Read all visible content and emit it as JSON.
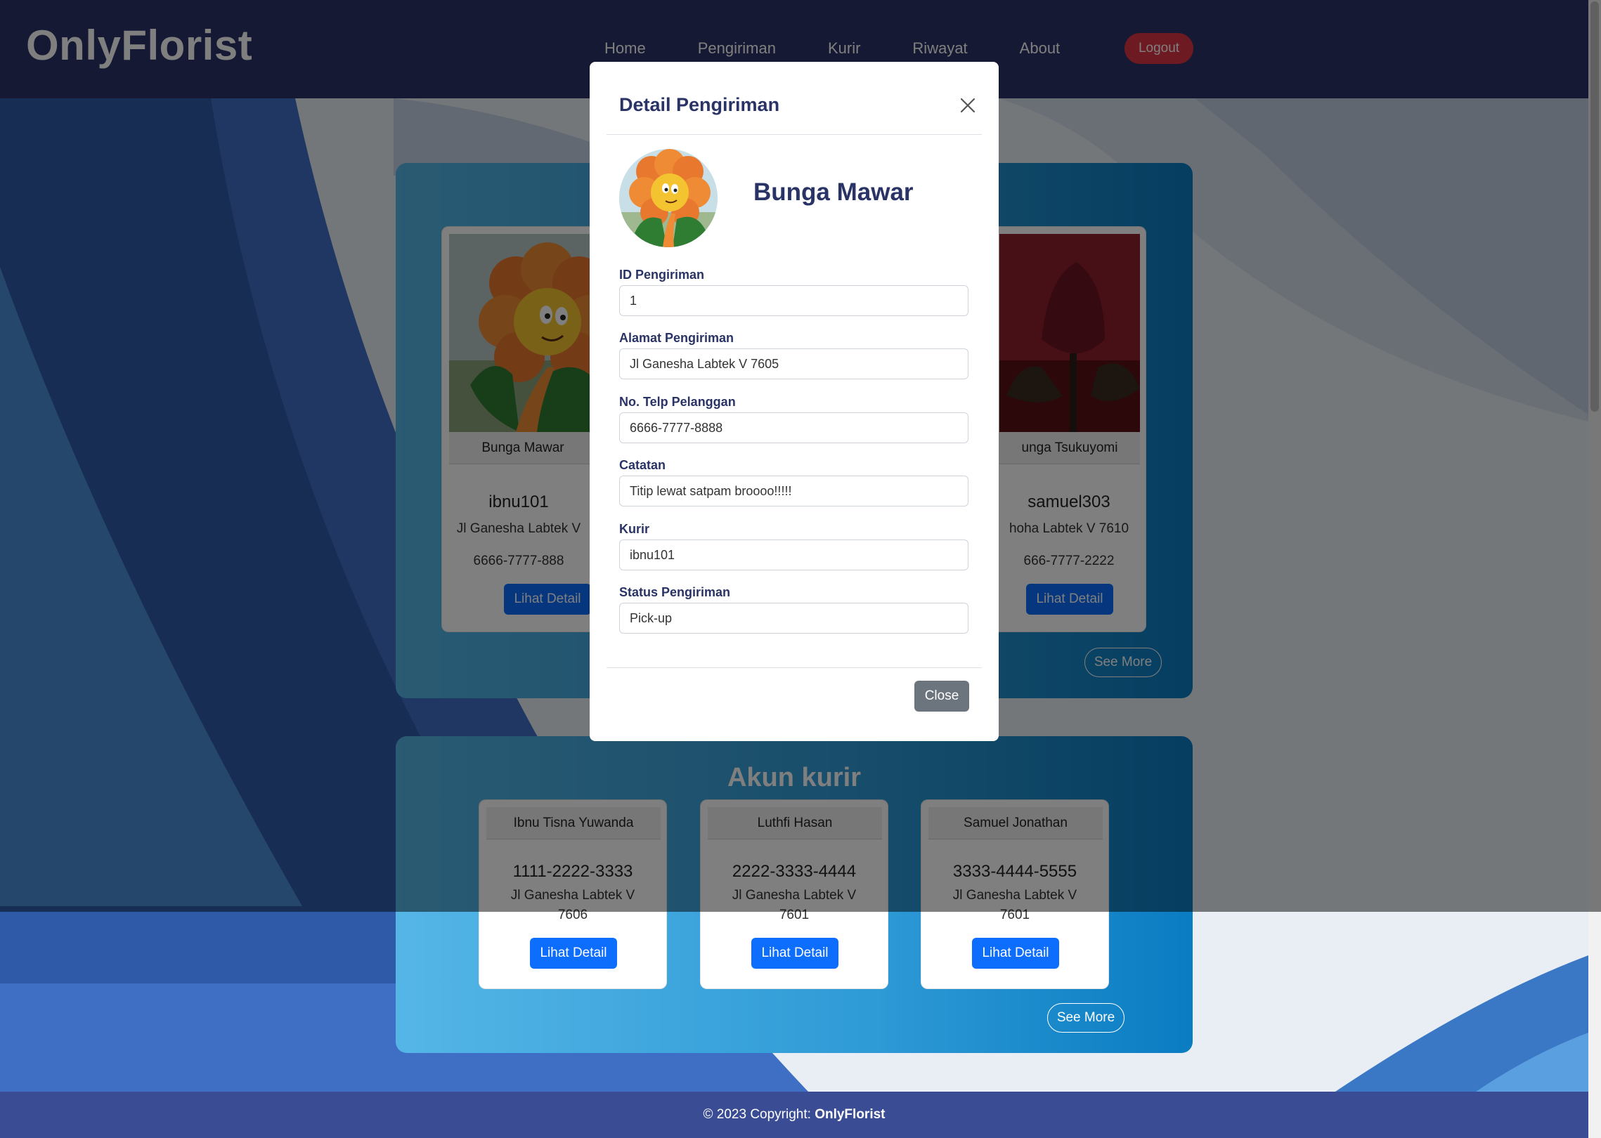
{
  "navbar": {
    "brand": "OnlyFlorist",
    "links": [
      "Home",
      "Pengiriman",
      "Kurir",
      "Riwayat",
      "About"
    ],
    "logout": "Logout"
  },
  "pengiriman_cards": [
    {
      "flower": "Bunga Mawar",
      "courier": "ibnu101",
      "address": "Jl Ganesha Labtek V",
      "phone": "6666-7777-888",
      "button": "Lihat Detail"
    },
    {
      "flower": "unga Tsukuyomi",
      "courier": "samuel303",
      "address": "hoha Labtek V 7610",
      "phone": "666-7777-2222",
      "button": "Lihat Detail"
    }
  ],
  "pengiriman_see_more": "See More",
  "kurir_section": {
    "title": "Akun kurir",
    "cards": [
      {
        "name": "Ibnu Tisna Yuwanda",
        "phone": "1111-2222-3333",
        "address_line1": "Jl Ganesha Labtek V",
        "address_line2": "7606",
        "button": "Lihat Detail"
      },
      {
        "name": "Luthfi Hasan",
        "phone": "2222-3333-4444",
        "address_line1": "Jl Ganesha Labtek V",
        "address_line2": "7601",
        "button": "Lihat Detail"
      },
      {
        "name": "Samuel Jonathan",
        "phone": "3333-4444-5555",
        "address_line1": "Jl Ganesha Labtek V",
        "address_line2": "7601",
        "button": "Lihat Detail"
      }
    ],
    "see_more": "See More"
  },
  "footer": {
    "prefix": "© 2023 Copyright: ",
    "brand": "OnlyFlorist"
  },
  "modal": {
    "title": "Detail Pengiriman",
    "flower_name": "Bunga Mawar",
    "fields": [
      {
        "label": "ID Pengiriman",
        "value": "1"
      },
      {
        "label": "Alamat Pengiriman",
        "value": "Jl Ganesha Labtek V 7605"
      },
      {
        "label": "No. Telp Pelanggan",
        "value": "6666-7777-8888"
      },
      {
        "label": "Catatan",
        "value": "Titip lewat satpam broooo!!!!!"
      },
      {
        "label": "Kurir",
        "value": "ibnu101"
      },
      {
        "label": "Status Pengiriman",
        "value": "Pick-up"
      }
    ],
    "close_button": "Close"
  },
  "colors": {
    "navbar": "#2a3366",
    "primary": "#0d6efd",
    "danger": "#dc3545",
    "secondary": "#6c757d"
  }
}
